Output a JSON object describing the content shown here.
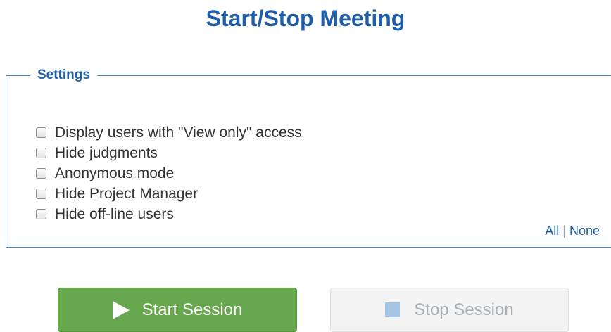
{
  "page": {
    "title": "Start/Stop Meeting"
  },
  "settings": {
    "legend": "Settings",
    "options": [
      {
        "label": "Display users with \"View only\" access",
        "checked": false
      },
      {
        "label": "Hide judgments",
        "checked": false
      },
      {
        "label": "Anonymous mode",
        "checked": false
      },
      {
        "label": "Hide Project Manager",
        "checked": false
      },
      {
        "label": "Hide off-line users",
        "checked": false
      }
    ],
    "select_all": "All",
    "separator": "|",
    "select_none": "None"
  },
  "actions": {
    "start_label": "Start Session",
    "stop_label": "Stop Session",
    "stop_enabled": false
  },
  "colors": {
    "accent": "#1f5ea8",
    "start_button": "#67a84f",
    "stop_icon": "#a6c4e4"
  }
}
